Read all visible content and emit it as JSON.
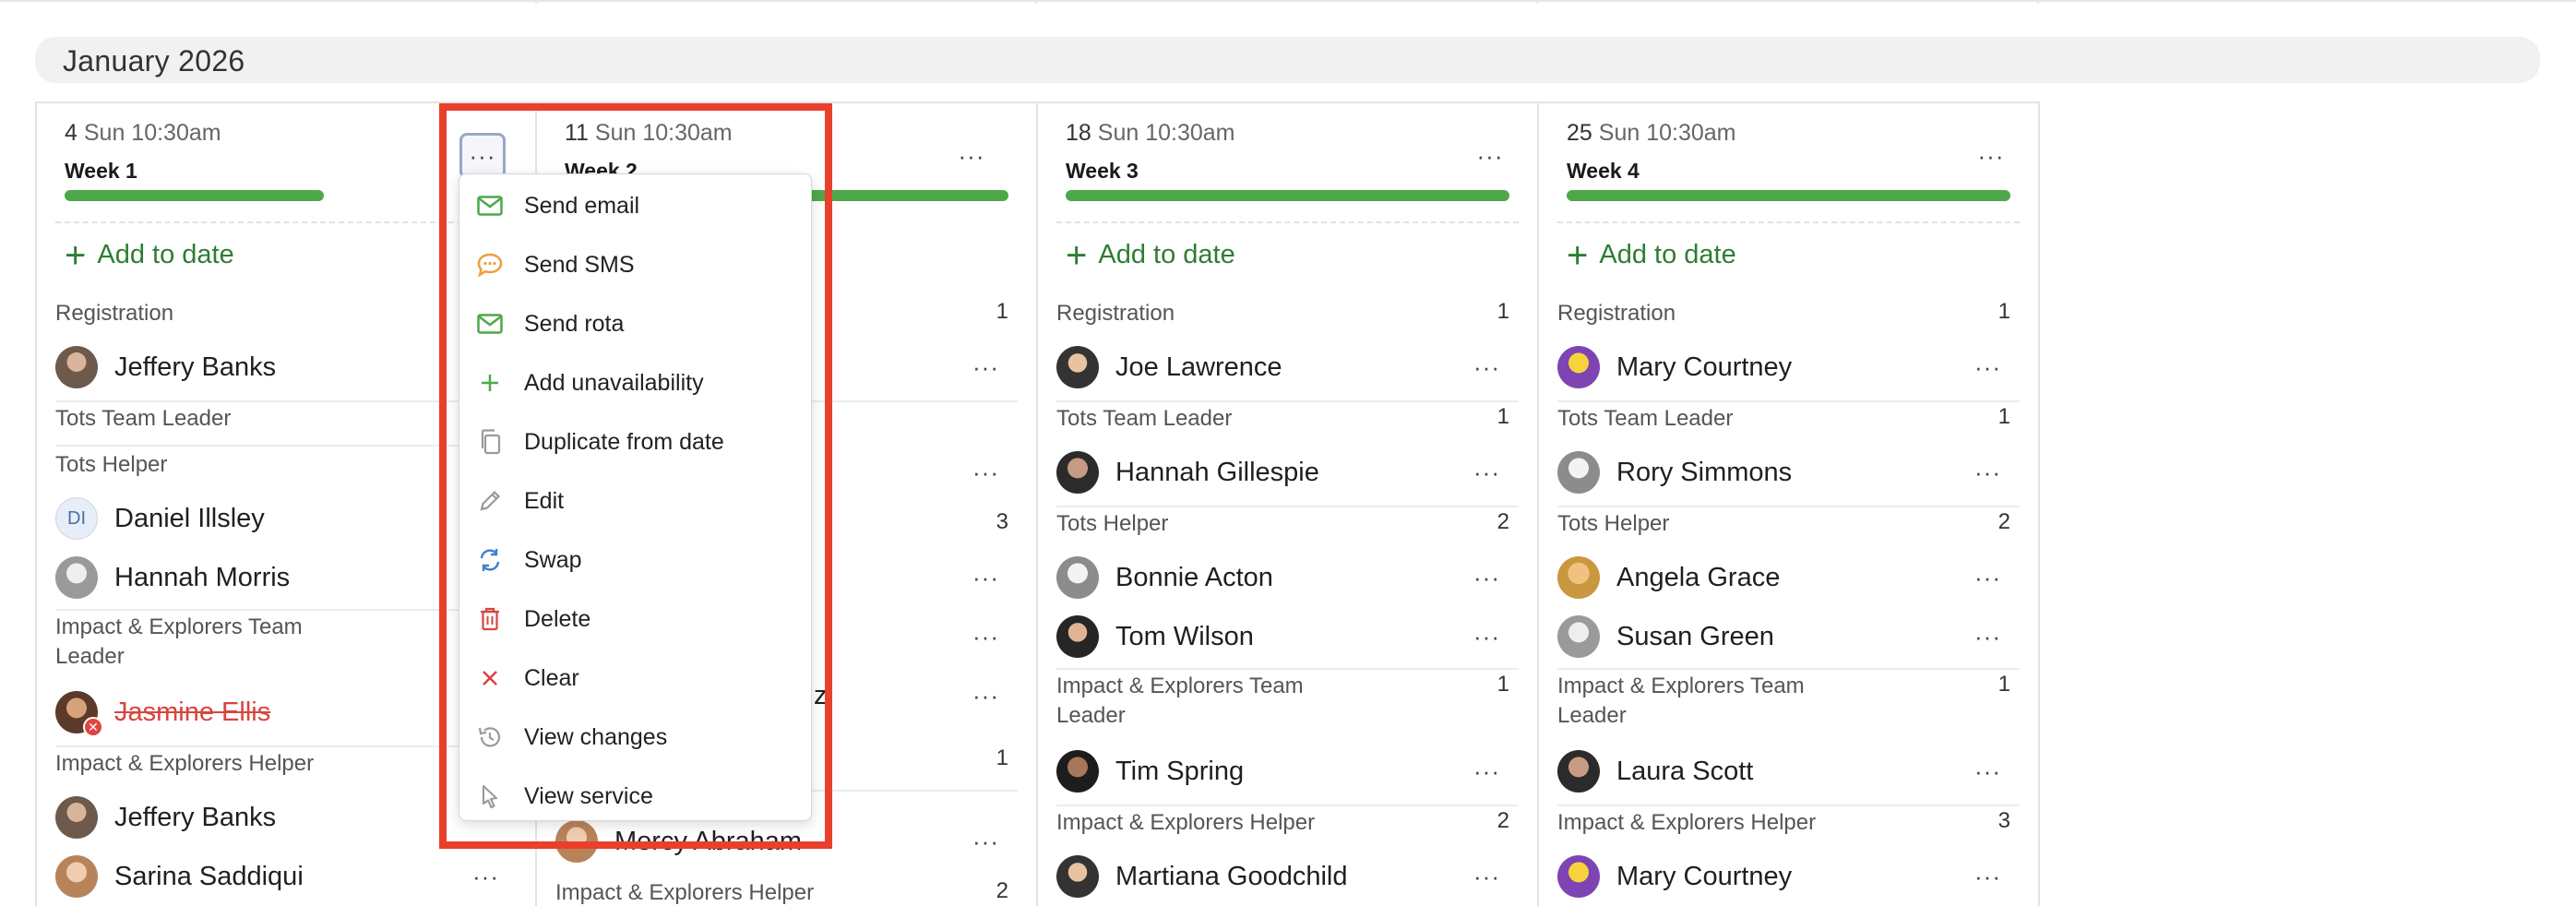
{
  "month": {
    "title": "January 2026"
  },
  "columns": [
    {
      "day": "4",
      "time": "Sun 10:30am",
      "week": "Week 1",
      "add_label": "Add to date",
      "role_registration": "Registration",
      "p1": "Jeffery Banks",
      "role_tots_leader": "Tots Team Leader",
      "role_tots_helper": "Tots Helper",
      "p2_initials": "DI",
      "p2": "Daniel Illsley",
      "p3": "Hannah Morris",
      "role_ie_leader": "Impact & Explorers Team Leader",
      "p4": "Jasmine Ellis",
      "role_ie_helper": "Impact & Explorers Helper",
      "p5": "Jeffery Banks",
      "p6": "Sarina Saddiqui"
    },
    {
      "day": "11",
      "time": "Sun 10:30am",
      "week": "Week 2",
      "c_registration": "1",
      "c_tots_helper": "3",
      "c_ie_leader": "1",
      "c_ie_helper": "2",
      "name_fragment": "z",
      "p_bottom": "Mercy Abraham",
      "role_ie_helper": "Impact & Explorers Helper"
    },
    {
      "day": "18",
      "time": "Sun 10:30am",
      "week": "Week 3",
      "add_label": "Add to date",
      "role_registration": "Registration",
      "c_registration": "1",
      "p1": "Joe Lawrence",
      "role_tots_leader": "Tots Team Leader",
      "c_tots_leader": "1",
      "p2": "Hannah Gillespie",
      "role_tots_helper": "Tots Helper",
      "c_tots_helper": "2",
      "p3": "Bonnie Acton",
      "p4": "Tom Wilson",
      "role_ie_leader": "Impact & Explorers Team Leader",
      "c_ie_leader": "1",
      "p5": "Tim Spring",
      "role_ie_helper": "Impact & Explorers Helper",
      "c_ie_helper": "2",
      "p6": "Martiana Goodchild"
    },
    {
      "day": "25",
      "time": "Sun 10:30am",
      "week": "Week 4",
      "add_label": "Add to date",
      "role_registration": "Registration",
      "c_registration": "1",
      "p1": "Mary Courtney",
      "role_tots_leader": "Tots Team Leader",
      "c_tots_leader": "1",
      "p2": "Rory Simmons",
      "role_tots_helper": "Tots Helper",
      "c_tots_helper": "2",
      "p3": "Angela Grace",
      "p4": "Susan Green",
      "role_ie_leader": "Impact & Explorers Team Leader",
      "c_ie_leader": "1",
      "p5": "Laura Scott",
      "role_ie_helper": "Impact & Explorers Helper",
      "c_ie_helper": "3",
      "p6": "Mary Courtney"
    }
  ],
  "menu": {
    "dots": "···",
    "items": [
      {
        "label": "Send email",
        "icon": "envelope-icon",
        "color": "#4ea84a"
      },
      {
        "label": "Send SMS",
        "icon": "chat-bubble-icon",
        "color": "#e8a23a"
      },
      {
        "label": "Send rota",
        "icon": "envelope-icon",
        "color": "#4ea84a"
      },
      {
        "label": "Add unavailability",
        "icon": "plus-icon",
        "color": "#4ea84a"
      },
      {
        "label": "Duplicate from date",
        "icon": "copy-icon",
        "color": "#9a9a9a"
      },
      {
        "label": "Edit",
        "icon": "pencil-icon",
        "color": "#9a9a9a"
      },
      {
        "label": "Swap",
        "icon": "swap-icon",
        "color": "#3f7fd1"
      },
      {
        "label": "Delete",
        "icon": "trash-icon",
        "color": "#d9443f"
      },
      {
        "label": "Clear",
        "icon": "close-icon",
        "color": "#d9443f"
      },
      {
        "label": "View changes",
        "icon": "history-icon",
        "color": "#9a9a9a"
      },
      {
        "label": "View service",
        "icon": "cursor-icon",
        "color": "#9a9a9a"
      }
    ]
  },
  "colors": {
    "accent_green": "#4ea84a",
    "highlight_red": "#e8402b"
  }
}
